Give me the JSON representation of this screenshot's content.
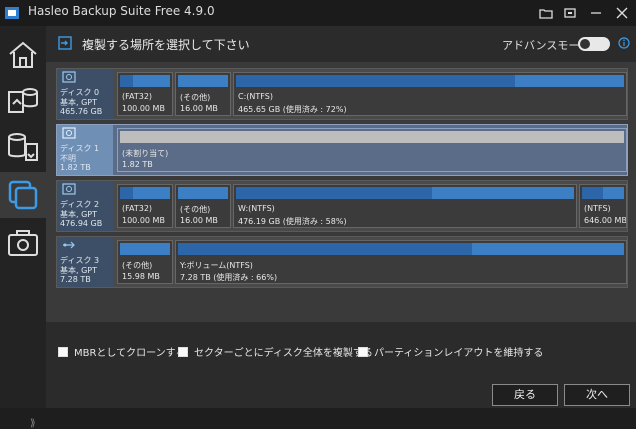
{
  "app": {
    "title": "Hasleo Backup Suite Free 4.9.0"
  },
  "titlebar": {
    "icons": [
      "folder-icon",
      "window-icon",
      "minimize-icon",
      "close-icon"
    ]
  },
  "sidebar": {
    "items": [
      "home-icon",
      "backup-icon",
      "restore-icon",
      "clone-icon",
      "tools-icon"
    ],
    "active": "clone-icon"
  },
  "header": {
    "title": "複製する場所を選択して下さい",
    "advanced_mode_label": "アドバンスモード",
    "advanced_mode_on": false
  },
  "disks": [
    {
      "name": "ディスク 0",
      "type": "基本, GPT",
      "size": "465.76 GB",
      "partitions": [
        {
          "label": "(FAT32)",
          "sub": "100.00 MB",
          "used": 0.25
        },
        {
          "label": "(その他)",
          "sub": "16.00 MB",
          "used": 0.0
        },
        {
          "label": "C:(NTFS)",
          "sub": "465.65 GB (使用済み : 72%)",
          "used": 0.72
        }
      ]
    },
    {
      "name": "ディスク 1",
      "type": "不明",
      "size": "1.82 TB",
      "selected": true,
      "partitions": [
        {
          "label": "(未割り当て)",
          "sub": "1.82 TB",
          "used": 0.0,
          "unallocated": true
        }
      ]
    },
    {
      "name": "ディスク 2",
      "type": "基本, GPT",
      "size": "476.94 GB",
      "partitions": [
        {
          "label": "(FAT32)",
          "sub": "100.00 MB",
          "used": 0.25
        },
        {
          "label": "(その他)",
          "sub": "16.00 MB",
          "used": 0.0
        },
        {
          "label": "W:(NTFS)",
          "sub": "476.19 GB (使用済み : 58%)",
          "used": 0.58
        },
        {
          "label": "(NTFS)",
          "sub": "646.00 MB",
          "used": 0.5
        }
      ]
    },
    {
      "name": "ディスク 3",
      "type": "基本, GPT",
      "size": "7.28 TB",
      "partitions": [
        {
          "label": "(その他)",
          "sub": "15.98 MB",
          "used": 0.0
        },
        {
          "label": "Y:ボリューム(NTFS)",
          "sub": "7.28 TB (使用済み : 66%)",
          "used": 0.66
        }
      ]
    }
  ],
  "options": {
    "mbr_clone": "MBRとしてクローンする",
    "sector_copy": "セクターごとにディスク全体を複製する",
    "keep_layout": "パーティションレイアウトを維持する"
  },
  "buttons": {
    "back": "戻る",
    "next": "次へ"
  },
  "colors": {
    "accent": "#3c7fc4",
    "used": "#2c66a8",
    "selected": "#5a6c88"
  }
}
